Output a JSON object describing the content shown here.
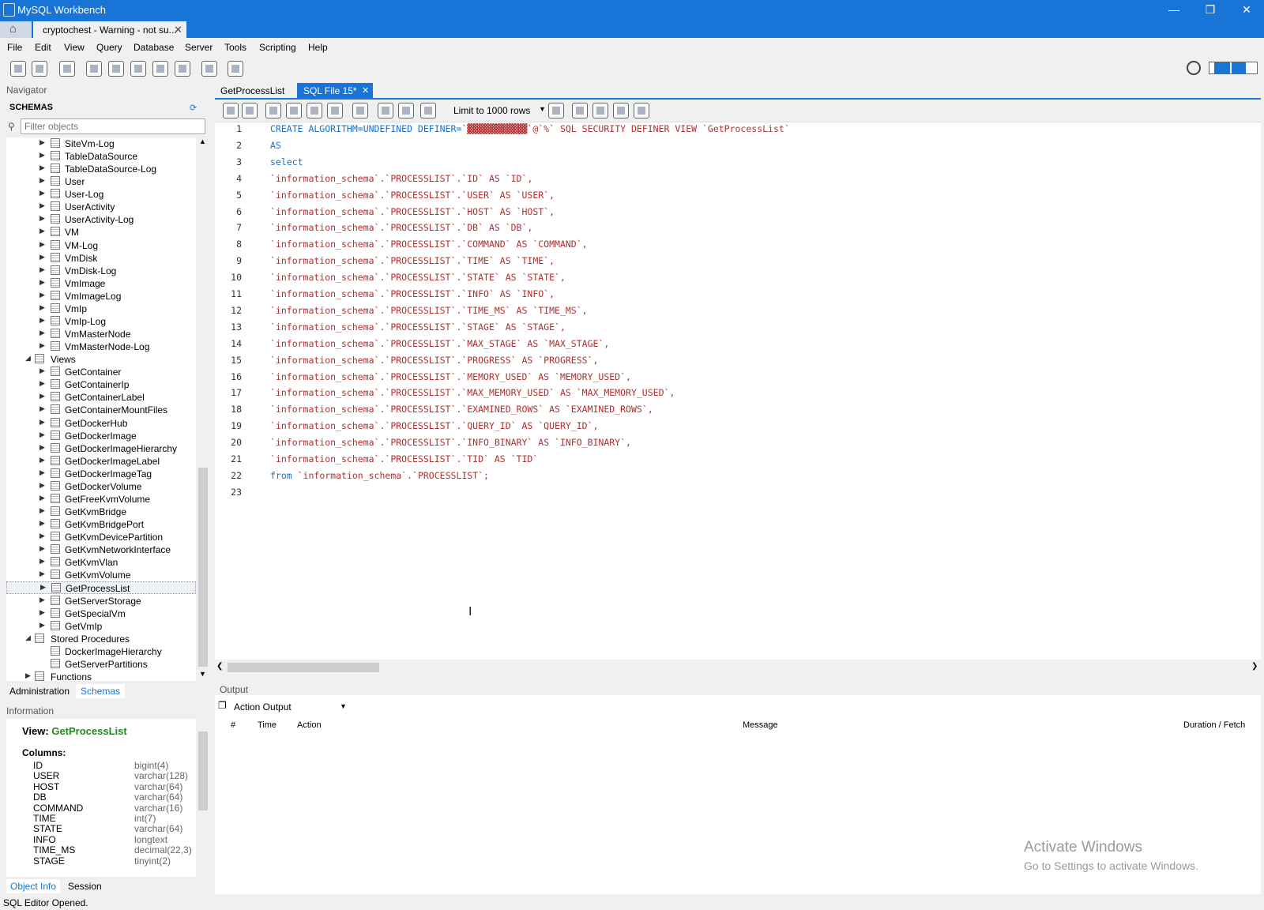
{
  "window": {
    "title": "MySQL Workbench"
  },
  "connection_tab": {
    "label": "cryptochest - Warning - not su..."
  },
  "menu": [
    "File",
    "Edit",
    "View",
    "Query",
    "Database",
    "Server",
    "Tools",
    "Scripting",
    "Help"
  ],
  "navigator": {
    "title": "Navigator",
    "schemas_label": "SCHEMAS",
    "filter_placeholder": "Filter objects",
    "tree": [
      {
        "label": "SiteVm-Log",
        "kind": "table"
      },
      {
        "label": "TableDataSource",
        "kind": "table"
      },
      {
        "label": "TableDataSource-Log",
        "kind": "table"
      },
      {
        "label": "User",
        "kind": "table"
      },
      {
        "label": "User-Log",
        "kind": "table"
      },
      {
        "label": "UserActivity",
        "kind": "table"
      },
      {
        "label": "UserActivity-Log",
        "kind": "table"
      },
      {
        "label": "VM",
        "kind": "table"
      },
      {
        "label": "VM-Log",
        "kind": "table"
      },
      {
        "label": "VmDisk",
        "kind": "table"
      },
      {
        "label": "VmDisk-Log",
        "kind": "table"
      },
      {
        "label": "VmImage",
        "kind": "table"
      },
      {
        "label": "VmImageLog",
        "kind": "table"
      },
      {
        "label": "VmIp",
        "kind": "table"
      },
      {
        "label": "VmIp-Log",
        "kind": "table"
      },
      {
        "label": "VmMasterNode",
        "kind": "table"
      },
      {
        "label": "VmMasterNode-Log",
        "kind": "table"
      },
      {
        "label": "Views",
        "kind": "folder"
      },
      {
        "label": "GetContainer",
        "kind": "view"
      },
      {
        "label": "GetContainerIp",
        "kind": "view"
      },
      {
        "label": "GetContainerLabel",
        "kind": "view"
      },
      {
        "label": "GetContainerMountFiles",
        "kind": "view"
      },
      {
        "label": "GetDockerHub",
        "kind": "view"
      },
      {
        "label": "GetDockerImage",
        "kind": "view"
      },
      {
        "label": "GetDockerImageHierarchy",
        "kind": "view"
      },
      {
        "label": "GetDockerImageLabel",
        "kind": "view"
      },
      {
        "label": "GetDockerImageTag",
        "kind": "view"
      },
      {
        "label": "GetDockerVolume",
        "kind": "view"
      },
      {
        "label": "GetFreeKvmVolume",
        "kind": "view"
      },
      {
        "label": "GetKvmBridge",
        "kind": "view"
      },
      {
        "label": "GetKvmBridgePort",
        "kind": "view"
      },
      {
        "label": "GetKvmDevicePartition",
        "kind": "view"
      },
      {
        "label": "GetKvmNetworkInterface",
        "kind": "view"
      },
      {
        "label": "GetKvmVlan",
        "kind": "view"
      },
      {
        "label": "GetKvmVolume",
        "kind": "view"
      },
      {
        "label": "GetProcessList",
        "kind": "view",
        "selected": true
      },
      {
        "label": "GetServerStorage",
        "kind": "view"
      },
      {
        "label": "GetSpecialVm",
        "kind": "view"
      },
      {
        "label": "GetVmIp",
        "kind": "view"
      },
      {
        "label": "Stored Procedures",
        "kind": "folder"
      },
      {
        "label": "DockerImageHierarchy",
        "kind": "proc"
      },
      {
        "label": "GetServerPartitions",
        "kind": "proc"
      },
      {
        "label": "Functions",
        "kind": "folder-collapsed"
      }
    ],
    "tabs": {
      "administration": "Administration",
      "schemas": "Schemas"
    }
  },
  "information": {
    "title": "Information",
    "view_prefix": "View:",
    "view_name": "GetProcessList",
    "columns_label": "Columns:",
    "columns": [
      {
        "name": "ID",
        "type": "bigint(4)"
      },
      {
        "name": "USER",
        "type": "varchar(128)"
      },
      {
        "name": "HOST",
        "type": "varchar(64)"
      },
      {
        "name": "DB",
        "type": "varchar(64)"
      },
      {
        "name": "COMMAND",
        "type": "varchar(16)"
      },
      {
        "name": "TIME",
        "type": "int(7)"
      },
      {
        "name": "STATE",
        "type": "varchar(64)"
      },
      {
        "name": "INFO",
        "type": "longtext"
      },
      {
        "name": "TIME_MS",
        "type": "decimal(22,3)"
      },
      {
        "name": "STAGE",
        "type": "tinyint(2)"
      }
    ],
    "tabs": {
      "object_info": "Object Info",
      "session": "Session"
    }
  },
  "editor_tabs": [
    {
      "label": "GetProcessList"
    },
    {
      "label": "SQL File 15*"
    }
  ],
  "editor_toolbar": {
    "limit": "Limit to 1000 rows"
  },
  "code_lines": [
    {
      "kw": "CREATE ALGORITHM=UNDEFINED DEFINER=",
      "rest": "`▓▓▓▓▓▓▓▓▓▓▓`@`%` SQL SECURITY DEFINER VIEW `GetProcessList`"
    },
    {
      "kw": "AS",
      "rest": ""
    },
    {
      "kw": "select",
      "rest": ""
    },
    {
      "kw": "",
      "rest": "`information_schema`.`PROCESSLIST`.`ID` AS `ID`,"
    },
    {
      "kw": "",
      "rest": "`information_schema`.`PROCESSLIST`.`USER` AS `USER`,"
    },
    {
      "kw": "",
      "rest": "`information_schema`.`PROCESSLIST`.`HOST` AS `HOST`,"
    },
    {
      "kw": "",
      "rest": "`information_schema`.`PROCESSLIST`.`DB` AS `DB`,"
    },
    {
      "kw": "",
      "rest": "`information_schema`.`PROCESSLIST`.`COMMAND` AS `COMMAND`,"
    },
    {
      "kw": "",
      "rest": "`information_schema`.`PROCESSLIST`.`TIME` AS `TIME`,"
    },
    {
      "kw": "",
      "rest": "`information_schema`.`PROCESSLIST`.`STATE` AS `STATE`,"
    },
    {
      "kw": "",
      "rest": "`information_schema`.`PROCESSLIST`.`INFO` AS `INFO`,"
    },
    {
      "kw": "",
      "rest": "`information_schema`.`PROCESSLIST`.`TIME_MS` AS `TIME_MS`,"
    },
    {
      "kw": "",
      "rest": "`information_schema`.`PROCESSLIST`.`STAGE` AS `STAGE`,"
    },
    {
      "kw": "",
      "rest": "`information_schema`.`PROCESSLIST`.`MAX_STAGE` AS `MAX_STAGE`,"
    },
    {
      "kw": "",
      "rest": "`information_schema`.`PROCESSLIST`.`PROGRESS` AS `PROGRESS`,"
    },
    {
      "kw": "",
      "rest": "`information_schema`.`PROCESSLIST`.`MEMORY_USED` AS `MEMORY_USED`,"
    },
    {
      "kw": "",
      "rest": "`information_schema`.`PROCESSLIST`.`MAX_MEMORY_USED` AS `MAX_MEMORY_USED`,"
    },
    {
      "kw": "",
      "rest": "`information_schema`.`PROCESSLIST`.`EXAMINED_ROWS` AS `EXAMINED_ROWS`,"
    },
    {
      "kw": "",
      "rest": "`information_schema`.`PROCESSLIST`.`QUERY_ID` AS `QUERY_ID`,"
    },
    {
      "kw": "",
      "rest": "`information_schema`.`PROCESSLIST`.`INFO_BINARY` AS `INFO_BINARY`,"
    },
    {
      "kw": "",
      "rest": "`information_schema`.`PROCESSLIST`.`TID` AS `TID`"
    },
    {
      "kw": "from",
      "rest": " `information_schema`.`PROCESSLIST`;"
    },
    {
      "kw": "",
      "rest": ""
    }
  ],
  "output": {
    "title": "Output",
    "selector": "Action Output",
    "headers": {
      "num": "#",
      "time": "Time",
      "action": "Action",
      "message": "Message",
      "duration": "Duration / Fetch"
    }
  },
  "watermark": {
    "line1": "Activate Windows",
    "line2": "Go to Settings to activate Windows."
  },
  "status": {
    "text": "SQL Editor Opened."
  },
  "colors": {
    "accent": "#1874d6",
    "keyword": "#1a6fc9",
    "identifier": "#b03030",
    "view_name": "#1e8a1e"
  }
}
